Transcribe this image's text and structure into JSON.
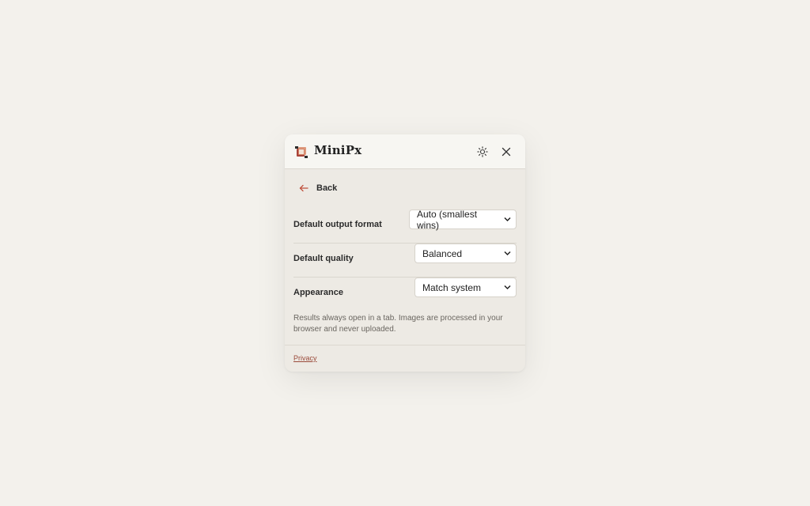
{
  "app": {
    "title": "MiniPx",
    "logo_icon": "minipx-logo-icon"
  },
  "header": {
    "settings_icon": "sun-gear-icon",
    "close_icon": "close-icon"
  },
  "back": {
    "label": "Back",
    "icon": "arrow-left-icon"
  },
  "settings": [
    {
      "label": "Default output format",
      "value": "Auto (smallest wins)"
    },
    {
      "label": "Default quality",
      "value": "Balanced"
    },
    {
      "label": "Appearance",
      "value": "Match system"
    }
  ],
  "note": "Results always open in a tab. Images are processed in your browser and never uploaded.",
  "footer": {
    "privacy_label": "Privacy"
  },
  "colors": {
    "background": "#f3f1ec",
    "panel": "#edeae4",
    "header": "#f7f6f2",
    "accent": "#c0503c",
    "link": "#9a4a3a"
  }
}
